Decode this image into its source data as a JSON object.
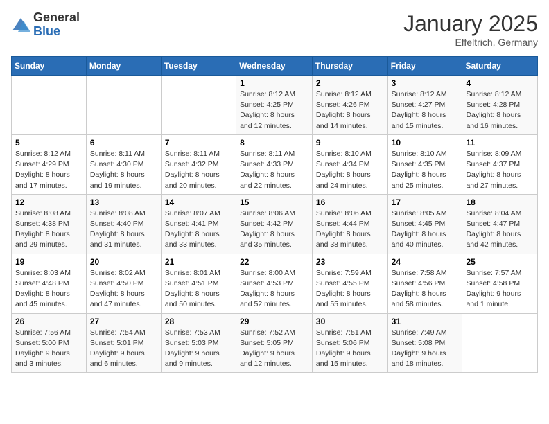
{
  "logo": {
    "general": "General",
    "blue": "Blue"
  },
  "title": "January 2025",
  "subtitle": "Effeltrich, Germany",
  "days_of_week": [
    "Sunday",
    "Monday",
    "Tuesday",
    "Wednesday",
    "Thursday",
    "Friday",
    "Saturday"
  ],
  "weeks": [
    [
      {
        "day": "",
        "info": ""
      },
      {
        "day": "",
        "info": ""
      },
      {
        "day": "",
        "info": ""
      },
      {
        "day": "1",
        "info": "Sunrise: 8:12 AM\nSunset: 4:25 PM\nDaylight: 8 hours\nand 12 minutes."
      },
      {
        "day": "2",
        "info": "Sunrise: 8:12 AM\nSunset: 4:26 PM\nDaylight: 8 hours\nand 14 minutes."
      },
      {
        "day": "3",
        "info": "Sunrise: 8:12 AM\nSunset: 4:27 PM\nDaylight: 8 hours\nand 15 minutes."
      },
      {
        "day": "4",
        "info": "Sunrise: 8:12 AM\nSunset: 4:28 PM\nDaylight: 8 hours\nand 16 minutes."
      }
    ],
    [
      {
        "day": "5",
        "info": "Sunrise: 8:12 AM\nSunset: 4:29 PM\nDaylight: 8 hours\nand 17 minutes."
      },
      {
        "day": "6",
        "info": "Sunrise: 8:11 AM\nSunset: 4:30 PM\nDaylight: 8 hours\nand 19 minutes."
      },
      {
        "day": "7",
        "info": "Sunrise: 8:11 AM\nSunset: 4:32 PM\nDaylight: 8 hours\nand 20 minutes."
      },
      {
        "day": "8",
        "info": "Sunrise: 8:11 AM\nSunset: 4:33 PM\nDaylight: 8 hours\nand 22 minutes."
      },
      {
        "day": "9",
        "info": "Sunrise: 8:10 AM\nSunset: 4:34 PM\nDaylight: 8 hours\nand 24 minutes."
      },
      {
        "day": "10",
        "info": "Sunrise: 8:10 AM\nSunset: 4:35 PM\nDaylight: 8 hours\nand 25 minutes."
      },
      {
        "day": "11",
        "info": "Sunrise: 8:09 AM\nSunset: 4:37 PM\nDaylight: 8 hours\nand 27 minutes."
      }
    ],
    [
      {
        "day": "12",
        "info": "Sunrise: 8:08 AM\nSunset: 4:38 PM\nDaylight: 8 hours\nand 29 minutes."
      },
      {
        "day": "13",
        "info": "Sunrise: 8:08 AM\nSunset: 4:40 PM\nDaylight: 8 hours\nand 31 minutes."
      },
      {
        "day": "14",
        "info": "Sunrise: 8:07 AM\nSunset: 4:41 PM\nDaylight: 8 hours\nand 33 minutes."
      },
      {
        "day": "15",
        "info": "Sunrise: 8:06 AM\nSunset: 4:42 PM\nDaylight: 8 hours\nand 35 minutes."
      },
      {
        "day": "16",
        "info": "Sunrise: 8:06 AM\nSunset: 4:44 PM\nDaylight: 8 hours\nand 38 minutes."
      },
      {
        "day": "17",
        "info": "Sunrise: 8:05 AM\nSunset: 4:45 PM\nDaylight: 8 hours\nand 40 minutes."
      },
      {
        "day": "18",
        "info": "Sunrise: 8:04 AM\nSunset: 4:47 PM\nDaylight: 8 hours\nand 42 minutes."
      }
    ],
    [
      {
        "day": "19",
        "info": "Sunrise: 8:03 AM\nSunset: 4:48 PM\nDaylight: 8 hours\nand 45 minutes."
      },
      {
        "day": "20",
        "info": "Sunrise: 8:02 AM\nSunset: 4:50 PM\nDaylight: 8 hours\nand 47 minutes."
      },
      {
        "day": "21",
        "info": "Sunrise: 8:01 AM\nSunset: 4:51 PM\nDaylight: 8 hours\nand 50 minutes."
      },
      {
        "day": "22",
        "info": "Sunrise: 8:00 AM\nSunset: 4:53 PM\nDaylight: 8 hours\nand 52 minutes."
      },
      {
        "day": "23",
        "info": "Sunrise: 7:59 AM\nSunset: 4:55 PM\nDaylight: 8 hours\nand 55 minutes."
      },
      {
        "day": "24",
        "info": "Sunrise: 7:58 AM\nSunset: 4:56 PM\nDaylight: 8 hours\nand 58 minutes."
      },
      {
        "day": "25",
        "info": "Sunrise: 7:57 AM\nSunset: 4:58 PM\nDaylight: 9 hours\nand 1 minute."
      }
    ],
    [
      {
        "day": "26",
        "info": "Sunrise: 7:56 AM\nSunset: 5:00 PM\nDaylight: 9 hours\nand 3 minutes."
      },
      {
        "day": "27",
        "info": "Sunrise: 7:54 AM\nSunset: 5:01 PM\nDaylight: 9 hours\nand 6 minutes."
      },
      {
        "day": "28",
        "info": "Sunrise: 7:53 AM\nSunset: 5:03 PM\nDaylight: 9 hours\nand 9 minutes."
      },
      {
        "day": "29",
        "info": "Sunrise: 7:52 AM\nSunset: 5:05 PM\nDaylight: 9 hours\nand 12 minutes."
      },
      {
        "day": "30",
        "info": "Sunrise: 7:51 AM\nSunset: 5:06 PM\nDaylight: 9 hours\nand 15 minutes."
      },
      {
        "day": "31",
        "info": "Sunrise: 7:49 AM\nSunset: 5:08 PM\nDaylight: 9 hours\nand 18 minutes."
      },
      {
        "day": "",
        "info": ""
      }
    ]
  ]
}
